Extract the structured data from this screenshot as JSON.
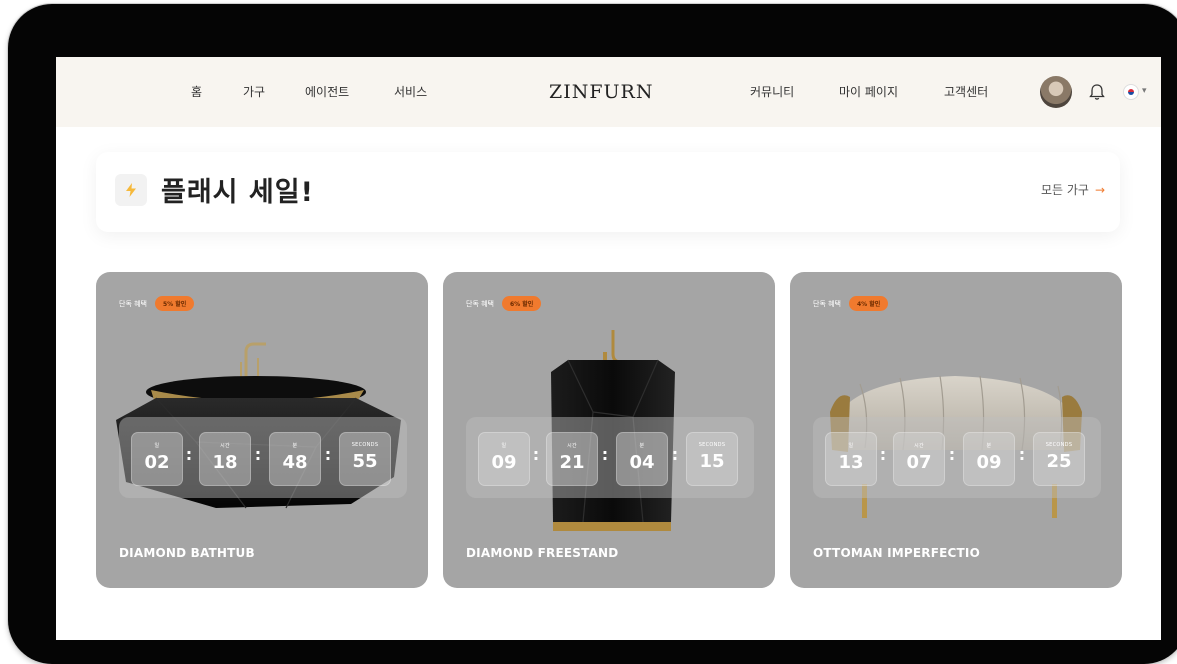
{
  "nav": {
    "left_links": [
      "홈",
      "가구",
      "에이전트",
      "서비스"
    ],
    "logo": "ZINFURN",
    "right_links": [
      "커뮤니티",
      "마이 페이지",
      "고객센터"
    ],
    "avatar_icon": "user-avatar",
    "notification_icon": "bell-icon",
    "language_icon": "korea-flag-icon",
    "language_dropdown_icon": "chevron-down-icon"
  },
  "flash_sale": {
    "icon": "lightning-icon",
    "title": "플래시 세일!",
    "all_link": "모든 가구",
    "all_link_arrow": "→",
    "accent": "#f07a2e"
  },
  "countdown_labels": {
    "days": "일",
    "hours": "시간",
    "minutes": "분",
    "seconds": "SECONDS"
  },
  "separator": ":",
  "cards": [
    {
      "tag": "단독 혜택",
      "discount": "5% 할인",
      "days": "02",
      "hours": "18",
      "minutes": "48",
      "seconds": "55",
      "name": "DIAMOND BATHTUB"
    },
    {
      "tag": "단독 혜택",
      "discount": "6% 할인",
      "days": "09",
      "hours": "21",
      "minutes": "04",
      "seconds": "15",
      "name": "DIAMOND FREESTAND"
    },
    {
      "tag": "단독 혜택",
      "discount": "4% 할인",
      "days": "13",
      "hours": "07",
      "minutes": "09",
      "seconds": "25",
      "name": "OTTOMAN IMPERFECTIO"
    }
  ],
  "colors": {
    "nav_bg": "#f8f5f0",
    "card_bg": "#a5a5a5",
    "badge": "#f07a2e"
  }
}
